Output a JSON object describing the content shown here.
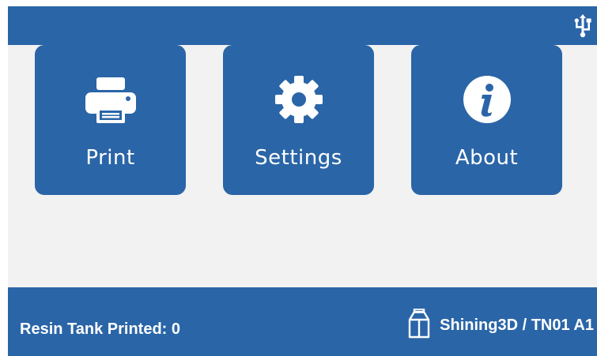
{
  "header": {
    "usb_icon": "usb-icon"
  },
  "menu": {
    "tiles": [
      {
        "id": "print",
        "label": "Print",
        "icon": "printer-icon"
      },
      {
        "id": "settings",
        "label": "Settings",
        "icon": "gear-icon"
      },
      {
        "id": "about",
        "label": "About",
        "icon": "info-icon"
      }
    ]
  },
  "footer": {
    "resin_status": "Resin Tank Printed: 0",
    "device_label": "Shining3D / TN01 A1",
    "device_icon": "resin-bottle-icon"
  },
  "colors": {
    "bar_blue": "#2a65a7",
    "tile_blue": "#2a65a7",
    "background": "#f2f2f2",
    "text": "#ffffff"
  }
}
